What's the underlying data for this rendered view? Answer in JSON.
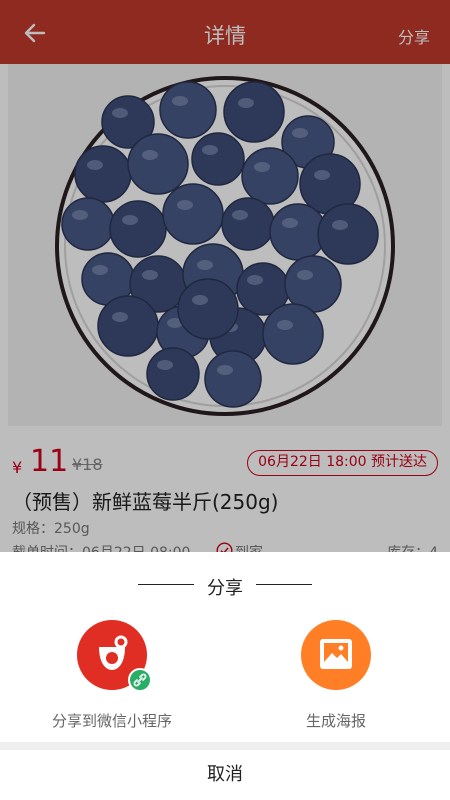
{
  "header": {
    "title": "详情",
    "share_label": "分享",
    "back_icon": "arrow-left-icon"
  },
  "product": {
    "currency": "¥",
    "price": "11",
    "original_price": "¥18",
    "delivery_badge": "06月22日 18:00 预计送达",
    "name": "（预售）新鲜蓝莓半斤(250g)",
    "spec": "规格：250g",
    "deadline": "截单时间：06月22日 08:00",
    "arrival_label": "到家",
    "stock": "库存：4"
  },
  "share_sheet": {
    "title": "分享",
    "options": [
      {
        "label": "分享到微信小程序",
        "icon": "wechat-miniprogram-icon",
        "color": "#e02e24"
      },
      {
        "label": "生成海报",
        "icon": "poster-image-icon",
        "color": "#ff7e26"
      }
    ],
    "cancel_label": "取消"
  },
  "colors": {
    "header": "#c0392b",
    "price": "#d0021b",
    "overlay": "rgba(0,0,0,0.26)"
  }
}
